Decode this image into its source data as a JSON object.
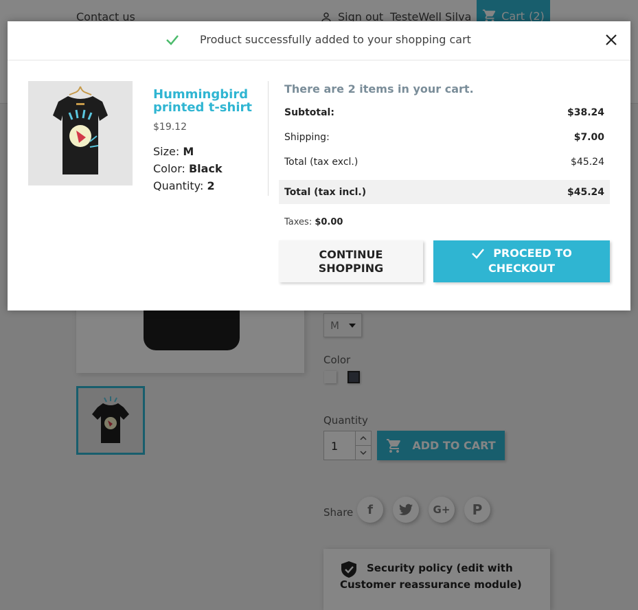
{
  "header": {
    "contact_link": "Contact us",
    "sign_out": "Sign out",
    "user_name": "TesteWell Silva",
    "cart_label": "Cart",
    "cart_count": "(2)"
  },
  "product_page": {
    "color_label": "Color",
    "size_value": "M",
    "quantity_label": "Quantity",
    "quantity_value": "1",
    "add_to_cart": "ADD TO CART",
    "share_label": "Share",
    "social_icons": [
      "facebook-icon",
      "twitter-icon",
      "google-plus-icon",
      "pinterest-icon"
    ],
    "reassurance_line1": "Security policy (edit with",
    "reassurance_line2": "Customer reassurance module)",
    "swatch_colors": [
      "#f3f3f3",
      "#434a56"
    ]
  },
  "modal": {
    "title": "Product successfully added to your shopping cart",
    "product": {
      "name": "Hummingbird printed t-shirt",
      "price": "$19.12",
      "size_label": "Size:",
      "size_value": "M",
      "color_label": "Color:",
      "color_value": "Black",
      "quantity_label": "Quantity:",
      "quantity_value": "2"
    },
    "cart_summary": {
      "count_text": "There are 2 items in your cart.",
      "subtotal_label": "Subtotal:",
      "subtotal_value": "$38.24",
      "shipping_label": "Shipping:",
      "shipping_value": "$7.00",
      "total_excl_label": "Total (tax excl.)",
      "total_excl_value": "$45.24",
      "total_incl_label": "Total (tax incl.)",
      "total_incl_value": "$45.24",
      "taxes_label": "Taxes:",
      "taxes_value": "$0.00"
    },
    "continue_line1": "CONTINUE",
    "continue_line2": "SHOPPING",
    "checkout_line1": "PROCEED TO",
    "checkout_line2": "CHECKOUT"
  },
  "colors": {
    "accent": "#2fb5d2",
    "success": "#4cbb6c",
    "overlay": "rgba(0,0,0,0.48)"
  }
}
